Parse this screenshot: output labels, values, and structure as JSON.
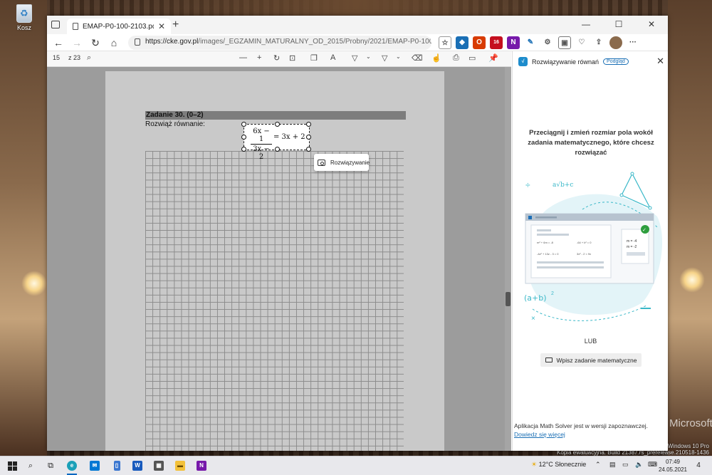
{
  "desktop": {
    "recycle_bin_label": "Kosz",
    "watermark_line1": "Windows 10 Pro",
    "watermark_line2": "Kopia ewaluacyjna. Build 21387.rs_prerelease.210518-1436",
    "bing_mark": "Microsoft Bing"
  },
  "browser": {
    "tab_title": "EMAP-P0-100-2103.pdf",
    "tab_close": "✕",
    "new_tab": "+",
    "window_controls": [
      "—",
      "☐",
      "✕"
    ],
    "url_host": "https://cke.gov.pl",
    "url_path": "/images/_EGZAMIN_MATURALNY_OD_2015/Probny/2021/EMAP-P0-100-2103.pdf",
    "extension_badge": "16",
    "more": "···"
  },
  "pdf": {
    "page_number": "15",
    "page_total": "z 23",
    "task_header": "Zadanie 30. (0–2)",
    "task_prompt": "Rozwiąż równanie:",
    "equation": {
      "numerator": "6x − 1",
      "denominator": "3x − 2",
      "rhs": "= 3x + 2"
    },
    "solve_button": "Rozwiązywanie"
  },
  "panel": {
    "title": "Rozwiązywanie równań",
    "badge": "Podgląd",
    "instruction": "Przeciągnij i zmień rozmiar pola wokół zadania matematycznego, które chcesz rozwiązać",
    "illustration": {
      "sqrt_text": "a√b+c",
      "binomial_text": "(a+b)",
      "binomial_power": "2",
      "eq1": "m² + 6m = -8",
      "eq2": "-64 + k² = 0",
      "eq3": "-4z² + 13z - 3 = 0",
      "eq4": "3x² - 2 < 9x",
      "result1": "m = -4",
      "result2": "m = -2"
    },
    "or_text": "LUB",
    "type_button": "Wpisz zadanie matematyczne",
    "preview_note": "Aplikacja Math Solver jest w wersji zapoznawczej.",
    "preview_link": "Dowiedz się więcej"
  },
  "taskbar": {
    "weather": "12°C Słonecznie",
    "time": "07:49",
    "date": "24.05.2021",
    "notifications": "4"
  },
  "colors": {
    "accent": "#0067c0",
    "link": "#1a6fb5",
    "illustration_teal": "#3ab8c8"
  }
}
